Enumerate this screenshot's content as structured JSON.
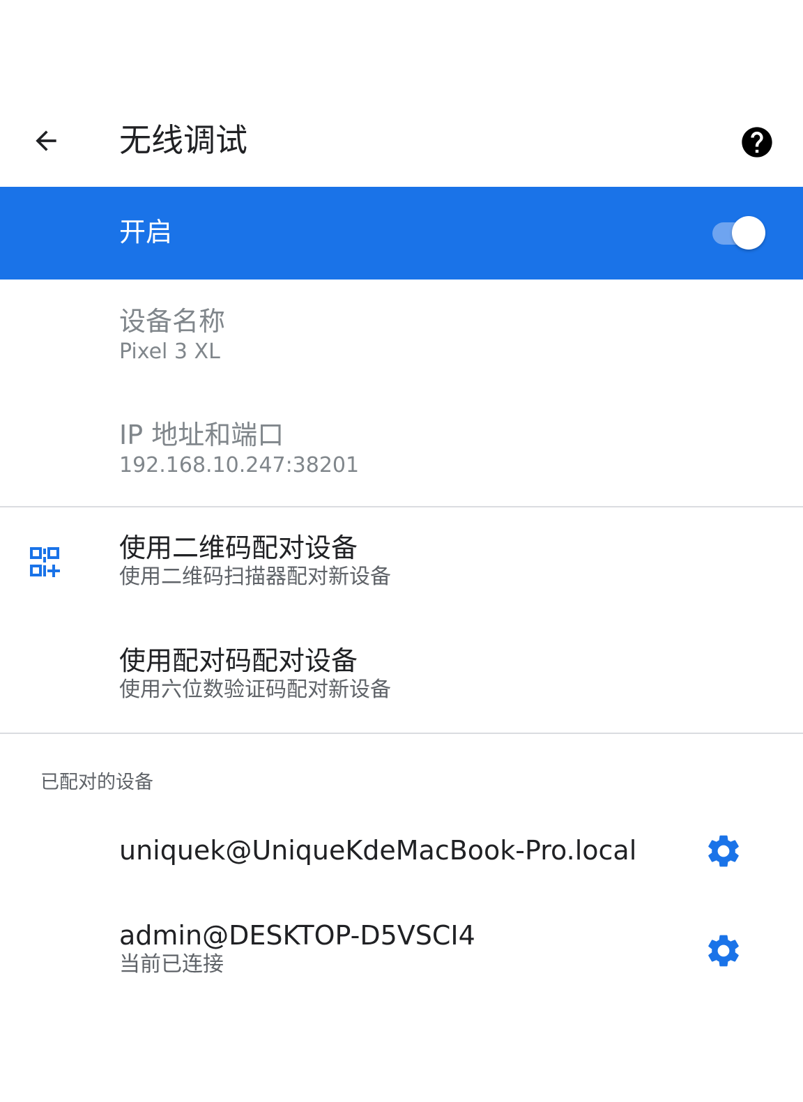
{
  "app_bar": {
    "title": "无线调试",
    "back_icon": "arrow-back-icon",
    "help_icon": "help-circle-icon"
  },
  "main_switch": {
    "label": "开启",
    "state": "on",
    "bar_color": "#1a73e8"
  },
  "device_info": {
    "name_title": "设备名称",
    "name_value": "Pixel 3 XL",
    "ip_title": "IP 地址和端口",
    "ip_value": "192.168.10.247:38201"
  },
  "pairing": {
    "qr": {
      "title": "使用二维码配对设备",
      "summary": "使用二维码扫描器配对新设备",
      "icon": "qr-code-scanner-icon"
    },
    "code": {
      "title": "使用配对码配对设备",
      "summary": "使用六位数验证码配对新设备"
    }
  },
  "paired_devices": {
    "header": "已配对的设备",
    "items": [
      {
        "name": "uniquek@UniqueKdeMacBook-Pro.local",
        "status": "",
        "icon": "gear-icon"
      },
      {
        "name": "admin@DESKTOP-D5VSCI4",
        "status": "当前已连接",
        "icon": "gear-icon"
      }
    ]
  },
  "colors": {
    "accent": "#1a73e8",
    "text_primary": "#202124",
    "text_secondary": "#5f6368",
    "divider": "#dadce0"
  }
}
